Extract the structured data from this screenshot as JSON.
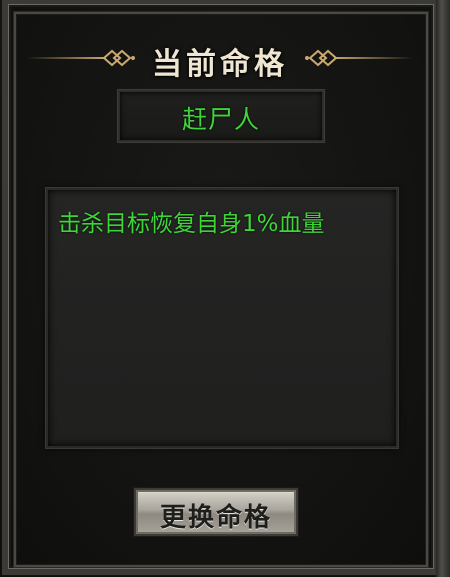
{
  "title": "当前命格",
  "fate_name": "赶尸人",
  "fate_description": "击杀目标恢复自身1%血量",
  "change_button_label": "更换命格",
  "colors": {
    "title": "#efe6d2",
    "green_text": "#3ed43a",
    "ornament_gold": "#caa870"
  },
  "icons": {
    "title_left": "ornament-knot-icon",
    "title_right": "ornament-knot-icon"
  }
}
